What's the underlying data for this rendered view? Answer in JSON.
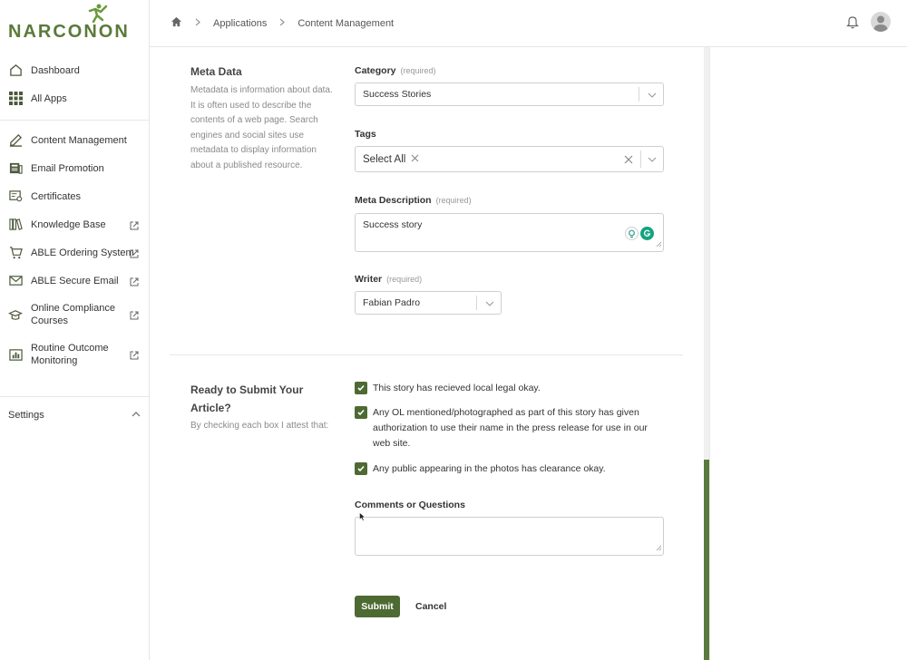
{
  "brand": {
    "logo_text": "NARCONON"
  },
  "sidebar": {
    "items": [
      {
        "label": "Dashboard",
        "icon": "home-icon"
      },
      {
        "label": "All Apps",
        "icon": "grid-icon"
      },
      {
        "label": "Content Management",
        "icon": "edit-icon"
      },
      {
        "label": "Email Promotion",
        "icon": "newspaper-icon"
      },
      {
        "label": "Certificates",
        "icon": "certificate-icon"
      },
      {
        "label": "Knowledge Base",
        "icon": "books-icon",
        "external": true
      },
      {
        "label": "ABLE Ordering System",
        "icon": "cart-icon",
        "external": true
      },
      {
        "label": "ABLE Secure Email",
        "icon": "mail-icon",
        "external": true
      },
      {
        "label": "Online Compliance Courses",
        "icon": "graduation-icon",
        "external": true
      },
      {
        "label": "Routine Outcome Monitoring",
        "icon": "chart-icon",
        "external": true
      }
    ],
    "settings_label": "Settings"
  },
  "breadcrumb": {
    "items": [
      "Applications",
      "Content Management"
    ]
  },
  "metadata_section": {
    "title": "Meta Data",
    "description": "Metadata is information about data. It is often used to describe the contents of a web page. Search engines and social sites use metadata to display information about a published resource."
  },
  "form": {
    "category": {
      "label": "Category",
      "required": "(required)",
      "value": "Success Stories"
    },
    "tags": {
      "label": "Tags",
      "chip": "Select All"
    },
    "meta_description": {
      "label": "Meta Description",
      "required": "(required)",
      "value": "Success story"
    },
    "writer": {
      "label": "Writer",
      "required": "(required)",
      "value": "Fabian Padro"
    }
  },
  "submit_section": {
    "title": "Ready to Submit Your Article?",
    "description": "By checking each box I attest that:",
    "checks": [
      {
        "text": "This story has recieved local legal okay.",
        "checked": true
      },
      {
        "text": "Any OL mentioned/photographed as part of this story has given authorization to use their name in the press release for use in our web site.",
        "checked": true
      },
      {
        "text": "Any public appearing in the photos has clearance okay.",
        "checked": true
      }
    ],
    "comments_label": "Comments or Questions",
    "submit_label": "Submit",
    "cancel_label": "Cancel"
  },
  "colors": {
    "accent": "#4e6a33",
    "brand_green": "#5a7a3a"
  }
}
